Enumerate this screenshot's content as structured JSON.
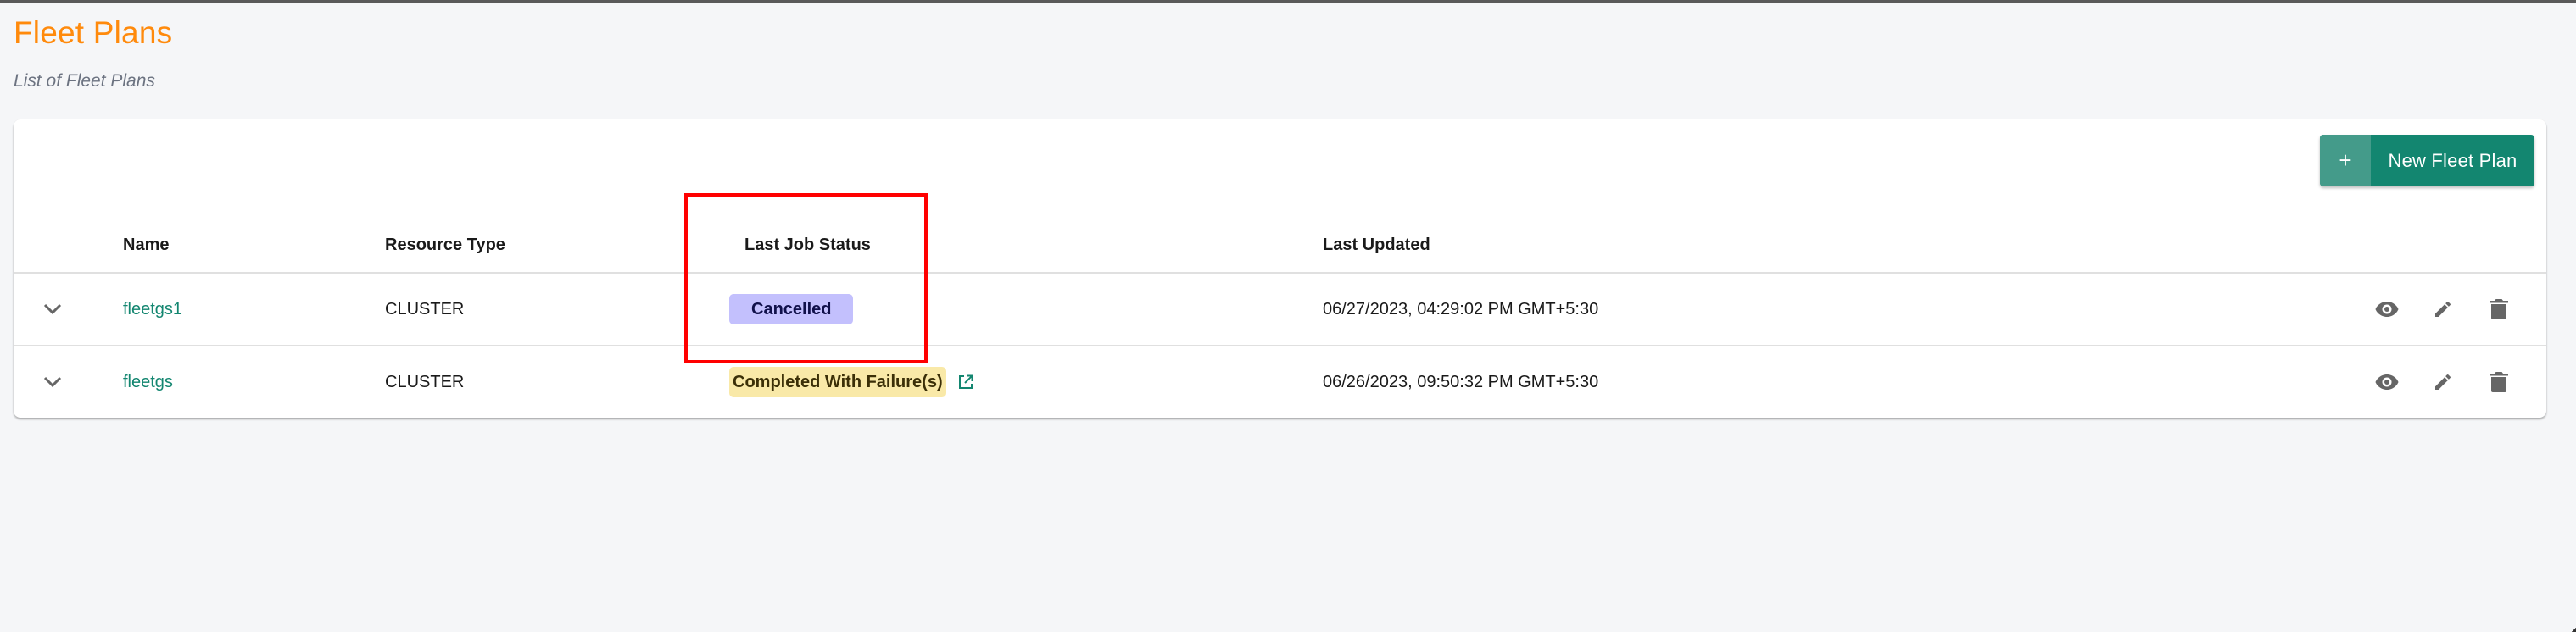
{
  "page": {
    "title": "Fleet Plans",
    "subtitle": "List of Fleet Plans"
  },
  "colors": {
    "title": "#ff8a0c",
    "brand": "#138670",
    "cancelled_badge": "#c3c0fd",
    "failure_badge": "#f9e9a8",
    "highlight": "#ff0000"
  },
  "toolbar": {
    "new_button_icon": "plus-icon",
    "new_button_plus": "+",
    "new_button_label": "New Fleet Plan"
  },
  "table": {
    "columns": [
      "",
      "Name",
      "Resource Type",
      "Last Job Status",
      "Last Updated",
      ""
    ],
    "rows": [
      {
        "expand_icon": "chevron-down-icon",
        "name": "fleetgs1",
        "resource_type": "CLUSTER",
        "last_job_status": "Cancelled",
        "status_kind": "cancelled",
        "status_link": false,
        "last_updated": "06/27/2023, 04:29:02 PM GMT+5:30",
        "actions": [
          "eye-icon",
          "pencil-icon",
          "trash-icon"
        ]
      },
      {
        "expand_icon": "chevron-down-icon",
        "name": "fleetgs",
        "resource_type": "CLUSTER",
        "last_job_status": "Completed With Failure(s)",
        "status_kind": "failure",
        "status_link": true,
        "last_updated": "06/26/2023, 09:50:32 PM GMT+5:30",
        "actions": [
          "eye-icon",
          "pencil-icon",
          "trash-icon"
        ]
      }
    ]
  }
}
